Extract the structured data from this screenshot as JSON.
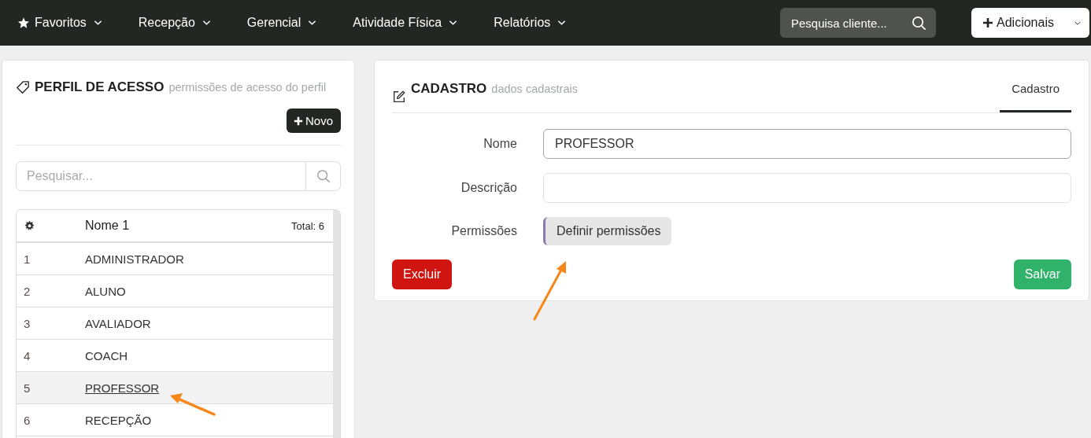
{
  "navbar": {
    "menus": [
      {
        "label": "Favoritos",
        "kind": "star"
      },
      {
        "label": "Recepção",
        "kind": "plain"
      },
      {
        "label": "Gerencial",
        "kind": "plain"
      },
      {
        "label": "Atividade Física",
        "kind": "plain"
      },
      {
        "label": "Relatórios",
        "kind": "plain"
      }
    ],
    "search": {
      "placeholder": "Pesquisa cliente..."
    },
    "add_button": {
      "label": "Adicionais"
    }
  },
  "left_panel": {
    "title": "PERFIL DE ACESSO",
    "subtitle": "permissões de acesso do perfil",
    "new_button": "Novo",
    "search": {
      "placeholder": "Pesquisar..."
    },
    "table": {
      "columns": [
        "Nome 1"
      ],
      "total": "Total: 6",
      "rows": [
        {
          "id": "1",
          "name": "ADMINISTRADOR",
          "selected": false
        },
        {
          "id": "2",
          "name": "ALUNO",
          "selected": false
        },
        {
          "id": "3",
          "name": "AVALIADOR",
          "selected": false
        },
        {
          "id": "4",
          "name": "COACH",
          "selected": false
        },
        {
          "id": "5",
          "name": "PROFESSOR",
          "selected": true
        },
        {
          "id": "6",
          "name": "RECEPÇÃO",
          "selected": false
        }
      ]
    }
  },
  "right_panel": {
    "title": "CADASTRO",
    "subtitle": "dados cadastrais",
    "tabs": [
      {
        "label": "Cadastro",
        "selected": true
      }
    ],
    "fields": [
      {
        "label": "Nome",
        "kind": "input",
        "value": "PROFESSOR"
      },
      {
        "label": "Descrição",
        "kind": "input"
      },
      {
        "label": "Permissões",
        "kind": "button",
        "button": "Definir permissões"
      }
    ],
    "delete_button": "Excluir",
    "save_button": "Salvar"
  }
}
